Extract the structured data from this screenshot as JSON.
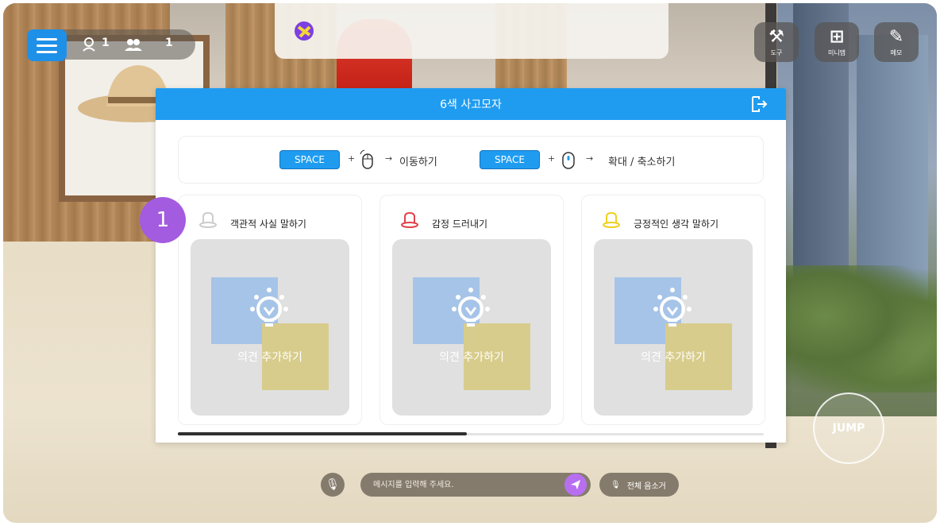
{
  "hud": {
    "self_count": "1",
    "participants_count": "1",
    "icons": [
      "menu-icon",
      "person-icon",
      "group-icon"
    ]
  },
  "tools": [
    {
      "label": "도구",
      "icon": "tools-icon"
    },
    {
      "label": "미니맵",
      "icon": "minimap-icon"
    },
    {
      "label": "메모",
      "icon": "memo-icon"
    }
  ],
  "modal": {
    "title": "6색 사고모자",
    "hints": {
      "key1": "SPACE",
      "plus1": "+",
      "arrow1": "→",
      "action1": "이동하기",
      "key2": "SPACE",
      "plus2": "+",
      "arrow2": "→",
      "action2": "확대 / 축소하기"
    },
    "cards": [
      {
        "title": "객관적 사실 말하기",
        "hat_color": "#dddddd",
        "add_label": "의견 추가하기"
      },
      {
        "title": "감정 드러내기",
        "hat_color": "#e0424a",
        "add_label": "의견 추가하기"
      },
      {
        "title": "긍정적인 생각 말하기",
        "hat_color": "#f0d020",
        "add_label": "의견 추가하기"
      }
    ]
  },
  "step_badge": "1",
  "jump_label": "JUMP",
  "chat": {
    "placeholder": "메시지를 입력해 주세요.",
    "mute_all_label": "전체 음소거"
  },
  "colors": {
    "accent": "#1f9cf0",
    "badge": "#a35be0",
    "send": "#b76ff0"
  }
}
